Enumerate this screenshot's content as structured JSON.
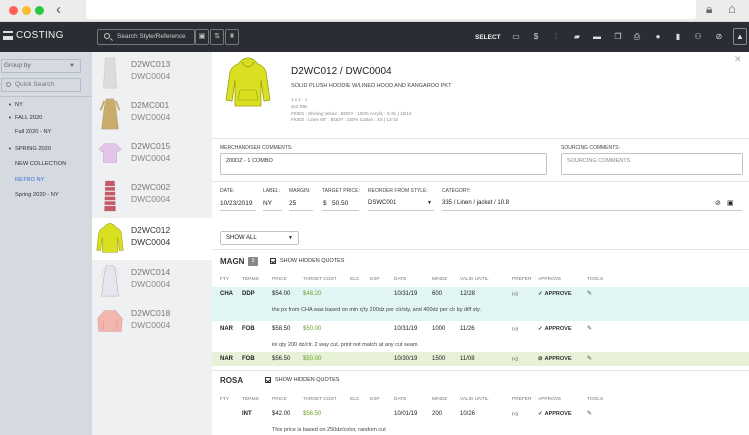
{
  "app": {
    "title": "COSTING",
    "search_placeholder": "Search Style/Reference",
    "select_label": "SELECT"
  },
  "icons": {
    "browser": [
      "back-arrow",
      "lock-icon",
      "home-icon"
    ],
    "header_buttons": [
      "save-icon",
      "sort-icon",
      "filter-icon"
    ],
    "toolbar": [
      "folder-icon",
      "dollar-icon",
      "sliders-icon",
      "comment-icon",
      "tag-icon",
      "copy-icon",
      "print-icon",
      "info-icon",
      "bookmark-icon",
      "users-icon",
      "block-icon",
      "alert-icon"
    ]
  },
  "sidebar": {
    "groupby_label": "Group by",
    "quicksearch_placeholder": "Quick Search",
    "tree": [
      {
        "label": "NY",
        "level": 0,
        "expandable": true
      },
      {
        "label": "FALL 2020",
        "level": 1,
        "expandable": true
      },
      {
        "label": "Fall 2020 - NY",
        "level": 2,
        "expandable": false
      },
      {
        "label": "SPRING 2020",
        "level": 1,
        "expandable": true
      },
      {
        "label": "NEW COLLECTION",
        "level": 2,
        "expandable": false
      },
      {
        "label": "RETRO NY",
        "level": 2,
        "expandable": false,
        "selected": true
      },
      {
        "label": "Spring 2020 - NY",
        "level": 2,
        "expandable": false
      }
    ]
  },
  "products": [
    {
      "code": "D2WC013",
      "ref": "DWC0004",
      "color": "#dcdcdc",
      "kind": "long-top"
    },
    {
      "code": "D2MC001",
      "ref": "DWC0004",
      "color": "#c9ab6a",
      "kind": "long-dress"
    },
    {
      "code": "D2WC015",
      "ref": "DWC0004",
      "color": "#e3c5ea",
      "kind": "tee"
    },
    {
      "code": "D2WC002",
      "ref": "DWC0004",
      "color": "#c25a6a",
      "kind": "striped-dress"
    },
    {
      "code": "D2WC012",
      "ref": "DWC0004",
      "color": "#d9e021",
      "kind": "hoodie",
      "active": true
    },
    {
      "code": "D2WC014",
      "ref": "DWC0004",
      "color": "#e6e6ee",
      "kind": "long-dress"
    },
    {
      "code": "D2WC018",
      "ref": "DWC0004",
      "color": "#f2b6ae",
      "kind": "sweater"
    }
  ],
  "detail": {
    "title": "D2WC012 / DWC0004",
    "description": "SOLID PLUSH HOODIE W/LINED HOOD AND KANGAROO PKT",
    "meta": [
      "1 x 1 - 1",
      "2x2 RIB",
      "FK001 : Shining Velour : BODY : 100% Acrylic : S-XL | 10/14",
      "FK002 : Linen 60\" : BODY : 100% Cotton : XS | 13-10"
    ],
    "merch_label": "MERCHANDISER COMMENTS:",
    "merch_value": "200DZ - 1 COMBO",
    "sourcing_label": "SOURCING COMMENTS:",
    "sourcing_placeholder": "SOURCING COMMENTS",
    "fields": {
      "date_label": "DATE:",
      "date": "10/23/2019",
      "label_label": "LABEL:",
      "label": "NY",
      "margin_label": "MARGIN:",
      "margin": "25",
      "target_label": "TARGET PRICE:",
      "target_currency": "$",
      "target": "50.50",
      "reorder_label": "REORDER FROM STYLE:",
      "reorder": "DSWC001",
      "category_label": "CATEGORY:",
      "category": "335 / Linen / jacket / 10.8"
    },
    "showall": "SHOW ALL"
  },
  "quote_columns": [
    "FTY",
    "TERMS",
    "PRICE",
    "TARGET COST",
    "ELC",
    "ESP",
    "DATE",
    "MINDZ",
    "VALID UNTIL",
    "PREFER",
    "APPROVE",
    "TOOLS"
  ],
  "groups": [
    {
      "name": "MAGN",
      "count": "3",
      "hidden_label": "SHOW HIDDEN QUOTES",
      "quotes": [
        {
          "fty": "CHA",
          "terms": "DDP",
          "price": "$54.00",
          "target": "$48.20",
          "date": "10/31/19",
          "mindz": "600",
          "valid": "12/28",
          "approve": "APPROVE",
          "state": "approved",
          "bg": "#e1f5f4",
          "comment": "the px from CHA was based on min q'ty 200dz per clr/sty, and 400dz per clr by diff sty."
        },
        {
          "fty": "NAR",
          "terms": "FOB",
          "price": "$58.50",
          "target": "$50.00",
          "date": "10/31/19",
          "mindz": "1000",
          "valid": "11/26",
          "approve": "APPROVE",
          "state": "none",
          "bg": "#ffffff",
          "comment": "ini qty 200 dz/clr. 2 way cut. print not match at any cut seam."
        },
        {
          "fty": "NAR",
          "terms": "FOB",
          "price": "$56.50",
          "target": "$50.00",
          "date": "10/30/19",
          "mindz": "1500",
          "valid": "11/08",
          "approve": "APPROVE",
          "state": "rejected",
          "bg": "#e6f1d7",
          "comment": ""
        }
      ]
    },
    {
      "name": "ROSA",
      "count": "",
      "hidden_label": "SHOW HIDDEN QUOTES",
      "quotes": [
        {
          "fty": "",
          "terms": "INT",
          "price": "$42.00",
          "target": "$56.50",
          "date": "10/01/19",
          "mindz": "200",
          "valid": "10/26",
          "approve": "APPROVE",
          "state": "none",
          "bg": "#ffffff",
          "comment": "This price is based on 250dz/color, random cut"
        }
      ]
    }
  ]
}
